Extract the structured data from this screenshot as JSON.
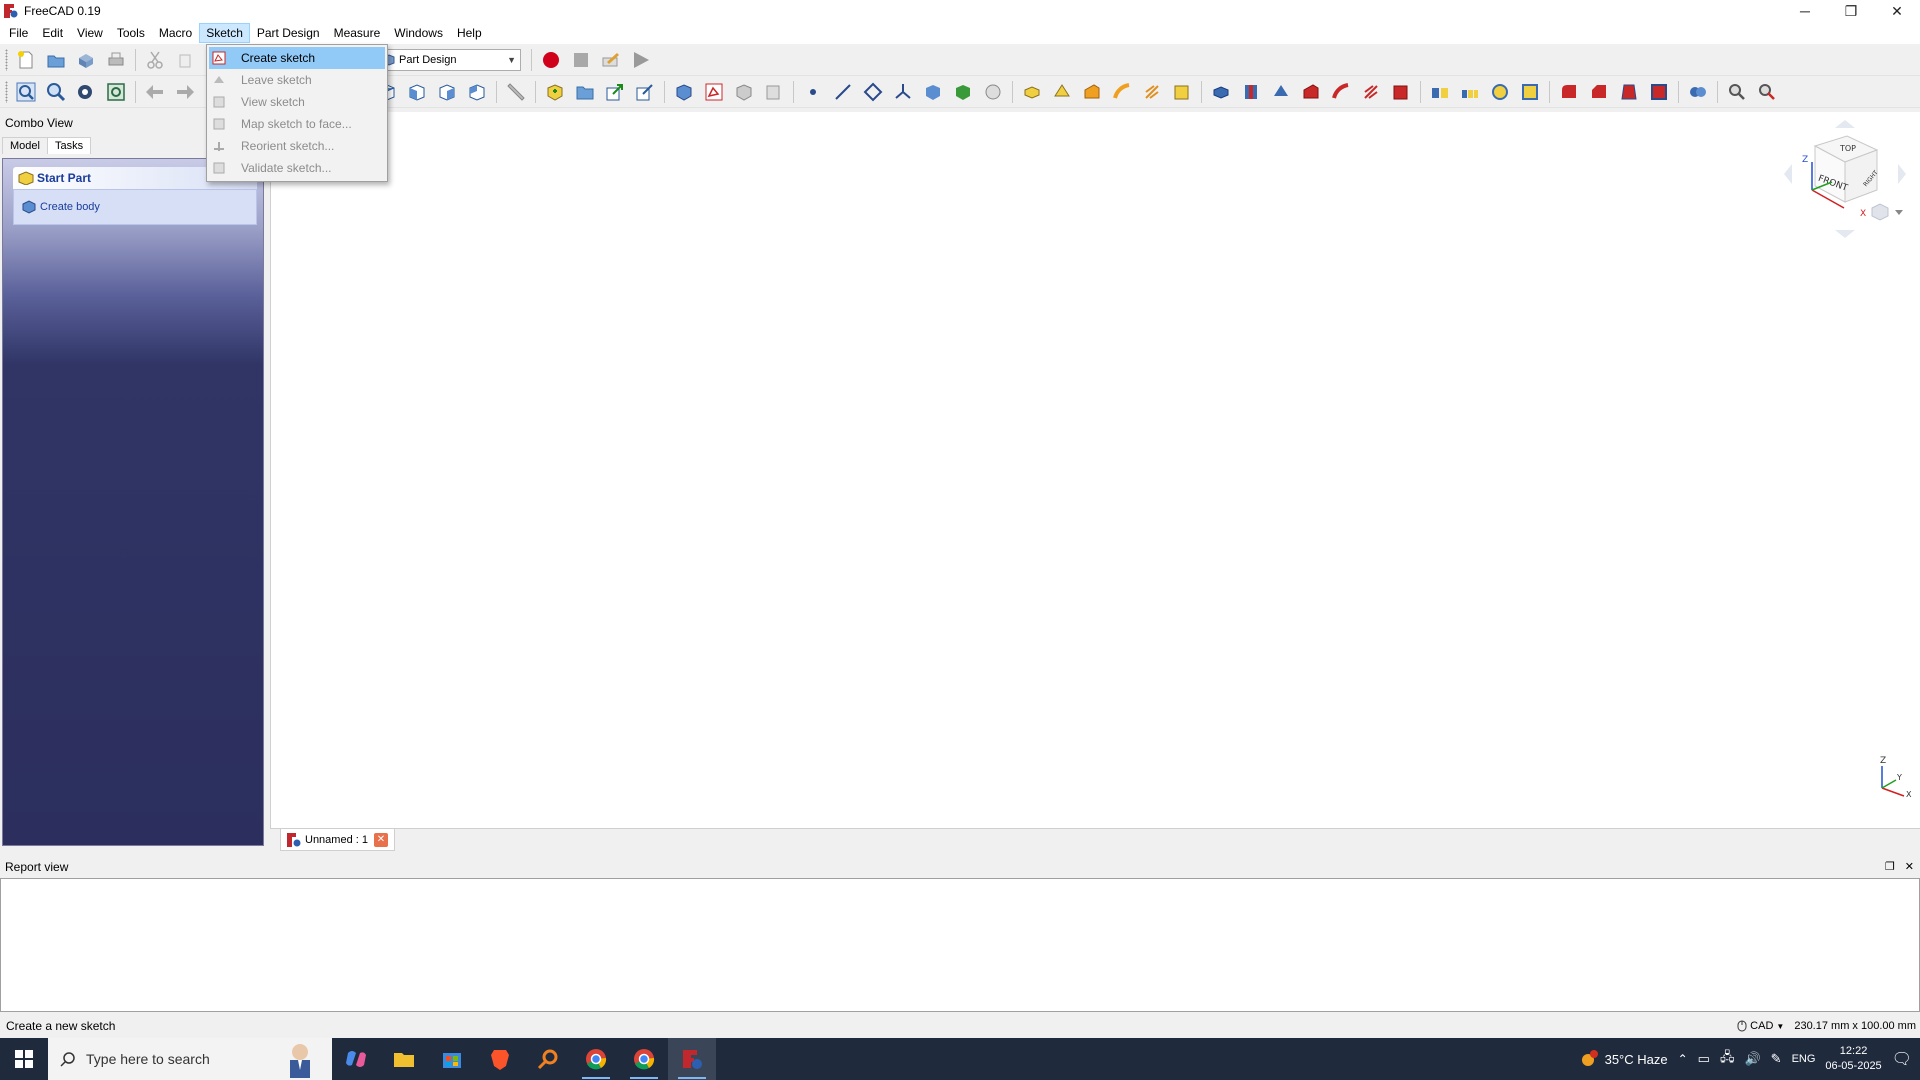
{
  "window": {
    "title": "FreeCAD 0.19",
    "minimize": "─",
    "restore": "❐",
    "close": "✕"
  },
  "menubar": [
    "File",
    "Edit",
    "View",
    "Tools",
    "Macro",
    "Sketch",
    "Part Design",
    "Measure",
    "Windows",
    "Help"
  ],
  "workbench": {
    "selected": "Part Design"
  },
  "sketch_menu": [
    {
      "label": "Create sketch",
      "state": "highlight"
    },
    {
      "label": "Leave sketch",
      "state": "disabled"
    },
    {
      "label": "View sketch",
      "state": "disabled"
    },
    {
      "label": "Map sketch to face...",
      "state": "disabled"
    },
    {
      "label": "Reorient sketch...",
      "state": "disabled"
    },
    {
      "label": "Validate sketch...",
      "state": "disabled"
    }
  ],
  "combo": {
    "title": "Combo View",
    "tabs": [
      "Model",
      "Tasks"
    ],
    "active_tab": "Tasks",
    "task_header": "Start Part",
    "task_action": "Create body"
  },
  "view3d": {
    "navcube_top": "TOP",
    "navcube_front": "FRONT",
    "navcube_right": "RIGHT",
    "axis_z": "Z",
    "axis_x": "X",
    "axis_y": "Y"
  },
  "doc_tab": {
    "label": "Unnamed : 1",
    "close": "✕"
  },
  "report": {
    "title": "Report view",
    "float": "❐",
    "close": "✕"
  },
  "statusbar": {
    "message": "Create a new sketch",
    "nav_style": "CAD",
    "dimensions": "230.17 mm x 100.00 mm"
  },
  "taskbar": {
    "search_placeholder": "Type here to search",
    "weather": "35°C  Haze",
    "lang": "ENG",
    "time": "12:22",
    "date": "06-05-2025"
  },
  "colors": {
    "accent_blue": "#1a3d9c",
    "menu_highlight": "#91c9f7",
    "taskbar": "#1f2a3d",
    "record": "#d0021b"
  }
}
